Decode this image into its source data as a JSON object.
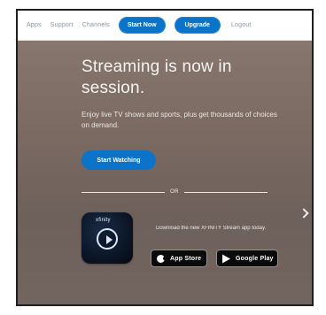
{
  "header": {
    "nav": [
      {
        "label": "Apps"
      },
      {
        "label": "Support"
      },
      {
        "label": "Channels"
      }
    ],
    "start_now_label": "Start Now",
    "upgrade_label": "Upgrade",
    "logout_label": "Logout"
  },
  "hero": {
    "headline_line1": "Streaming is now in",
    "headline_line2": "session.",
    "subhead": "Enjoy live TV shows and sports, plus get thousands of choices on demand."
  },
  "cta": {
    "start_watching_label": "Start Watching"
  },
  "divider": {
    "or_label": "OR"
  },
  "app": {
    "brand": "xfinity",
    "download_text": "Download the new XFINITY Stream app today.",
    "app_store_label": "App Store",
    "google_play_label": "Google Play"
  },
  "colors": {
    "accent": "#0b73c8"
  },
  "icons": {
    "play": "play-icon",
    "apple": "apple-icon",
    "google_play": "google-play-icon",
    "chevron": "chevron-right-icon"
  }
}
